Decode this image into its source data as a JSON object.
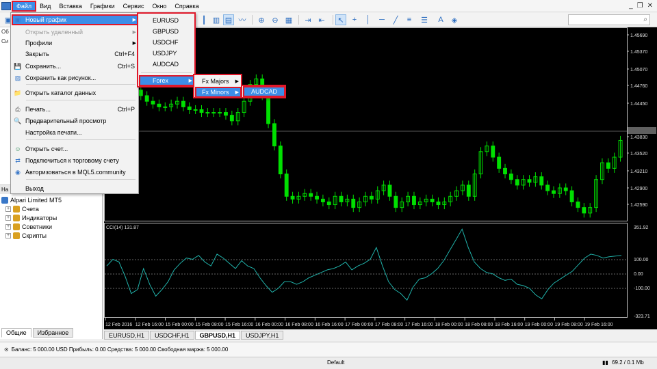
{
  "menubar": {
    "items": [
      "Файл",
      "Вид",
      "Вставка",
      "Графики",
      "Сервис",
      "Окно",
      "Справка"
    ],
    "active_index": 0,
    "window_buttons": [
      "_",
      "❐",
      "✕"
    ]
  },
  "file_menu": {
    "items": [
      {
        "label": "Новый график",
        "shortcut": "",
        "submenu": true,
        "highlighted": true,
        "disabled": false,
        "icon": "new-chart-icon"
      },
      {
        "label": "Открыть удаленный",
        "shortcut": "",
        "submenu": true,
        "highlighted": false,
        "disabled": true,
        "icon": ""
      },
      {
        "label": "Профили",
        "shortcut": "",
        "submenu": true,
        "highlighted": false,
        "disabled": false,
        "icon": ""
      },
      {
        "label": "Закрыть",
        "shortcut": "Ctrl+F4",
        "submenu": false,
        "highlighted": false,
        "disabled": false,
        "icon": ""
      },
      {
        "label": "Сохранить...",
        "shortcut": "Ctrl+S",
        "submenu": false,
        "highlighted": false,
        "disabled": false,
        "icon": "save-icon"
      },
      {
        "label": "Сохранить как рисунок...",
        "shortcut": "",
        "submenu": false,
        "highlighted": false,
        "disabled": false,
        "icon": "picture-icon"
      },
      {
        "label": "Открыть каталог данных",
        "shortcut": "",
        "submenu": false,
        "highlighted": false,
        "disabled": false,
        "icon": "folder-icon"
      },
      {
        "label": "Печать...",
        "shortcut": "Ctrl+P",
        "submenu": false,
        "highlighted": false,
        "disabled": false,
        "icon": "print-icon"
      },
      {
        "label": "Предварительный просмотр",
        "shortcut": "",
        "submenu": false,
        "highlighted": false,
        "disabled": false,
        "icon": "preview-icon"
      },
      {
        "label": "Настройка печати...",
        "shortcut": "",
        "submenu": false,
        "highlighted": false,
        "disabled": false,
        "icon": ""
      },
      {
        "label": "Открыть счет...",
        "shortcut": "",
        "submenu": false,
        "highlighted": false,
        "disabled": false,
        "icon": "account-icon"
      },
      {
        "label": "Подключиться к торговому счету",
        "shortcut": "",
        "submenu": false,
        "highlighted": false,
        "disabled": false,
        "icon": "connect-icon"
      },
      {
        "label": "Авторизоваться в MQL5.community",
        "shortcut": "",
        "submenu": false,
        "highlighted": false,
        "disabled": false,
        "icon": "mql5-icon"
      },
      {
        "label": "Выход",
        "shortcut": "",
        "submenu": false,
        "highlighted": false,
        "disabled": false,
        "icon": ""
      }
    ]
  },
  "symbol_menu": {
    "items": [
      "EURUSD",
      "GBPUSD",
      "USDCHF",
      "USDJPY",
      "AUDCAD"
    ],
    "forex_label": "Forex"
  },
  "forex_menu": {
    "items": [
      "Fx Majors",
      "Fx Minors"
    ]
  },
  "minors_menu": {
    "items": [
      "AUDCAD"
    ]
  },
  "navigator": {
    "header": "На",
    "tree": [
      {
        "label": "Alpari Limited MT5",
        "expandable": false,
        "color": "#3a78c8"
      },
      {
        "label": "Счета",
        "expandable": true,
        "color": "#d9a020"
      },
      {
        "label": "Индикаторы",
        "expandable": true,
        "color": "#d9a020"
      },
      {
        "label": "Советники",
        "expandable": true,
        "color": "#d9a020"
      },
      {
        "label": "Скрипты",
        "expandable": true,
        "color": "#d9a020"
      }
    ],
    "tabs": [
      "Общие",
      "Избранное"
    ],
    "market_watch_header": "Об",
    "market_watch_sub": "Си"
  },
  "search": {
    "placeholder": ""
  },
  "chart": {
    "symbol_tabs": [
      "EURUSD,H1",
      "USDCHF,H1",
      "GBPUSD,H1",
      "USDJPY,H1"
    ],
    "active_tab_index": 2,
    "price_labels": [
      "1.45690",
      "1.45370",
      "1.45070",
      "1.44760",
      "1.44450",
      "1.43937",
      "1.43830",
      "1.43520",
      "1.43210",
      "1.42900",
      "1.42590"
    ],
    "current_price": "1.43937",
    "indicator_label": "CCI(14) 131.87",
    "cci_labels": [
      "351.92",
      "100.00",
      "0.00",
      "-100.00",
      "-323.71"
    ],
    "time_labels": [
      "12 Feb 2016",
      "12 Feb 16:00",
      "15 Feb 00:00",
      "15 Feb 08:00",
      "15 Feb 16:00",
      "16 Feb 00:00",
      "16 Feb 08:00",
      "16 Feb 16:00",
      "17 Feb 00:00",
      "17 Feb 08:00",
      "17 Feb 16:00",
      "18 Feb 00:00",
      "18 Feb 08:00",
      "18 Feb 16:00",
      "19 Feb 00:00",
      "19 Feb 08:00",
      "19 Feb 16:00"
    ],
    "colors": {
      "bg": "#000000",
      "candle": "#00e000",
      "cci": "#20b2aa",
      "grid": "#8a8a8a",
      "text": "#e0e0e0"
    }
  },
  "status": {
    "balance_text": "Баланс: 5 000.00 USD  Прибыль: 0.00  Средства: 5 000.00  Свободная маржа: 5 000.00"
  },
  "bottombar": {
    "profile": "Default",
    "traffic": "69.2 / 0.1 Mb"
  }
}
